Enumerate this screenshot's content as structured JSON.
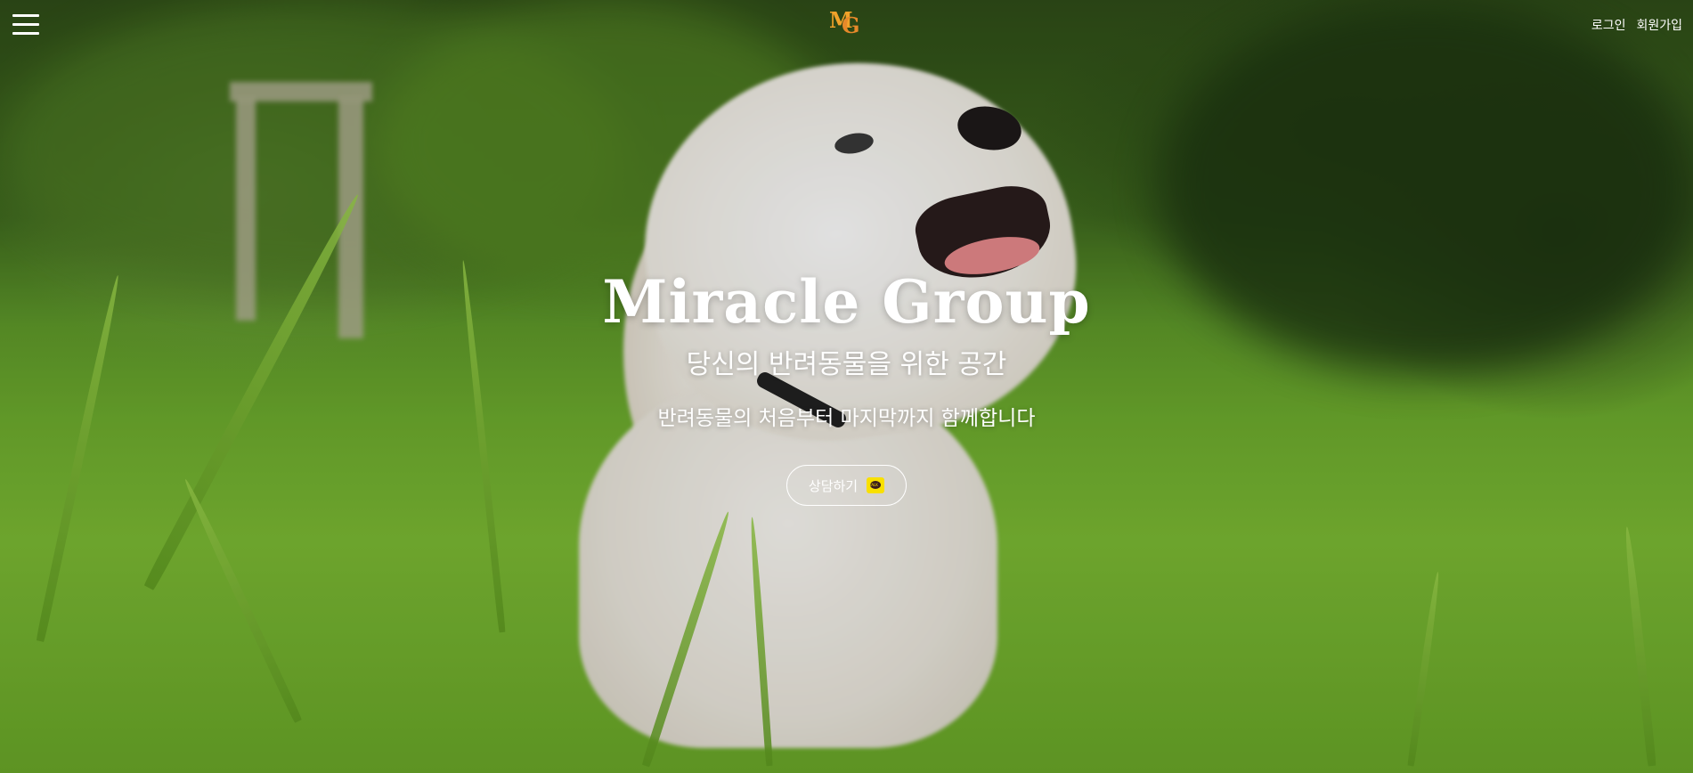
{
  "header": {
    "logo_letters": "MG",
    "login_label": "로그인",
    "signup_label": "회원가입"
  },
  "hero": {
    "title": "Miracle Group",
    "subtitle": "당신의 반려동물을 위한 공간",
    "description": "반려동물의 처음부터 마지막까지 함께합니다",
    "cta_label": "상담하기",
    "cta_icon": "kakaotalk-icon"
  },
  "colors": {
    "logo_m": "#f0a22a",
    "logo_g": "#e6892a",
    "text": "#ffffff",
    "kakao_yellow": "#f9e000"
  }
}
